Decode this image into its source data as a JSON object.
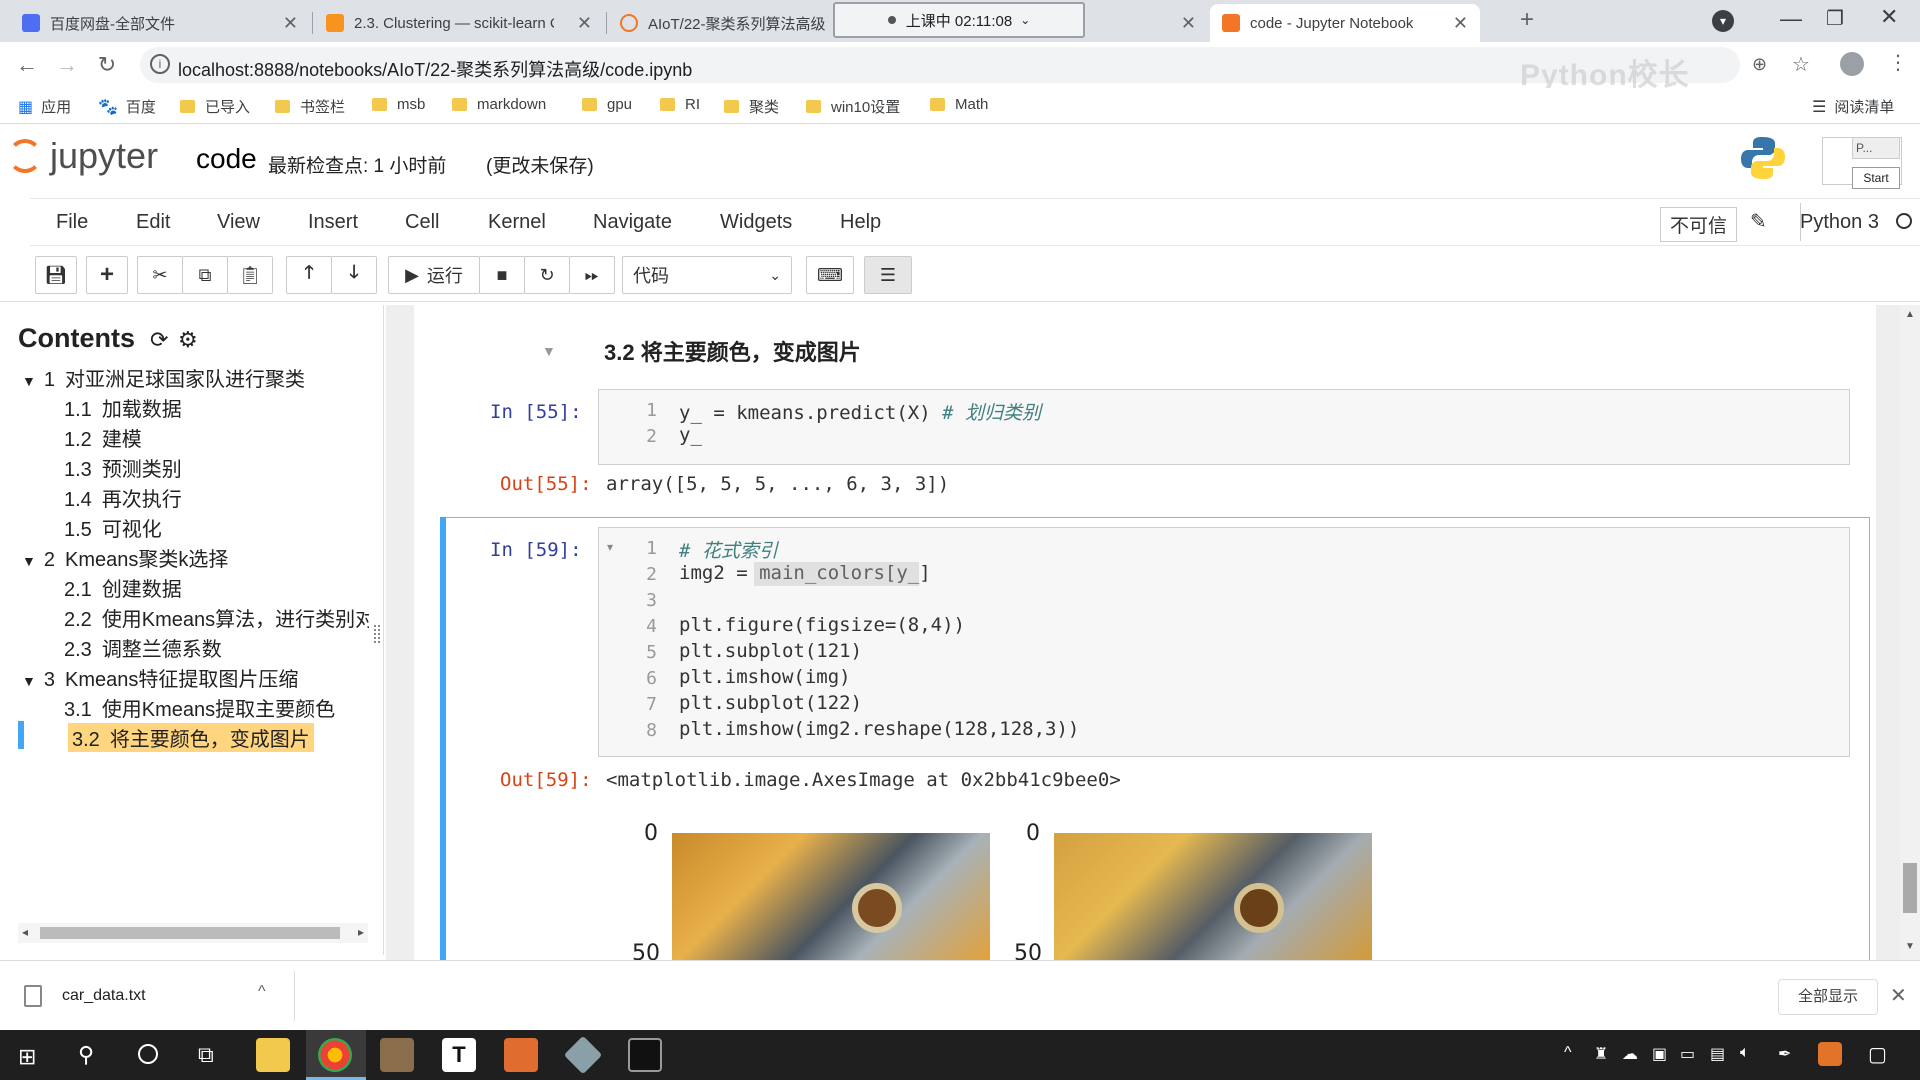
{
  "browser": {
    "tabs": [
      {
        "title": "百度网盘-全部文件"
      },
      {
        "title": "2.3. Clustering — scikit-learn C"
      },
      {
        "title": "AIoT/22-聚类系列算法高级"
      },
      {
        "title": "code - Jupyter Notebook"
      }
    ],
    "recording_indicator": "上课中 02:11:08",
    "new_tab": "+",
    "url": "localhost:8888/notebooks/AIoT/22-聚类系列算法高级/code.ipynb",
    "bookmarks": [
      "应用",
      "百度",
      "已导入",
      "书签栏",
      "msb",
      "markdown",
      "gpu",
      "RI",
      "聚类",
      "win10设置",
      "Math"
    ],
    "reading_list": "阅读清单",
    "watermark": "Python校长"
  },
  "jupyter": {
    "logo_text": "jupyter",
    "notebook_name": "code",
    "checkpoint": "最新检查点: 1 小时前",
    "unsaved": "(更改未保存)",
    "menus": [
      "File",
      "Edit",
      "View",
      "Insert",
      "Cell",
      "Kernel",
      "Navigate",
      "Widgets",
      "Help"
    ],
    "trust": "不可信",
    "kernel": "Python 3",
    "run_label": "运行",
    "cell_type": "代码",
    "popup_start": "Start",
    "popup_p": "P..."
  },
  "toc": {
    "title": "Contents",
    "items": [
      {
        "num": "1",
        "label": "对亚洲足球国家队进行聚类",
        "level": 1
      },
      {
        "num": "1.1",
        "label": "加载数据",
        "level": 2
      },
      {
        "num": "1.2",
        "label": "建模",
        "level": 2
      },
      {
        "num": "1.3",
        "label": "预测类别",
        "level": 2
      },
      {
        "num": "1.4",
        "label": "再次执行",
        "level": 2
      },
      {
        "num": "1.5",
        "label": "可视化",
        "level": 2
      },
      {
        "num": "2",
        "label": "Kmeans聚类k选择",
        "level": 1
      },
      {
        "num": "2.1",
        "label": "创建数据",
        "level": 2
      },
      {
        "num": "2.2",
        "label": "使用Kmeans算法，进行类别对",
        "level": 2
      },
      {
        "num": "2.3",
        "label": "调整兰德系数",
        "level": 2
      },
      {
        "num": "3",
        "label": "Kmeans特征提取图片压缩",
        "level": 1
      },
      {
        "num": "3.1",
        "label": "使用Kmeans提取主要颜色",
        "level": 2
      },
      {
        "num": "3.2",
        "label": "将主要颜色，变成图片",
        "level": 2,
        "active": true
      }
    ]
  },
  "notebook": {
    "heading": "3.2 将主要颜色，变成图片",
    "cell1": {
      "prompt_in": "In  [55]:",
      "lines": [
        {
          "n": "1",
          "code": "y_ = kmeans.predict(X) ",
          "comment": "# 划归类别"
        },
        {
          "n": "2",
          "code": "y_",
          "comment": ""
        }
      ],
      "prompt_out": "Out[55]:",
      "output": "array([5, 5, 5, ..., 6, 3, 3])"
    },
    "cell2": {
      "prompt_in": "In  [59]:",
      "lines": [
        {
          "n": "1",
          "code": "",
          "comment": "# 花式索引"
        },
        {
          "n": "2",
          "code": "img2 = main_colors[y_]",
          "comment": ""
        },
        {
          "n": "3",
          "code": "",
          "comment": ""
        },
        {
          "n": "4",
          "code": "plt.figure(figsize=(8,4))",
          "comment": ""
        },
        {
          "n": "5",
          "code": "plt.subplot(121)",
          "comment": ""
        },
        {
          "n": "6",
          "code": "plt.imshow(img)",
          "comment": ""
        },
        {
          "n": "7",
          "code": "plt.subplot(122)",
          "comment": ""
        },
        {
          "n": "8",
          "code": "plt.imshow(img2.reshape(128,128,3))",
          "comment": ""
        }
      ],
      "prompt_out": "Out[59]:",
      "output": "<matplotlib.image.AxesImage at 0x2bb41c9bee0>",
      "axis_ticks": [
        "0",
        "50"
      ]
    }
  },
  "download": {
    "file": "car_data.txt",
    "show_all": "全部显示"
  }
}
